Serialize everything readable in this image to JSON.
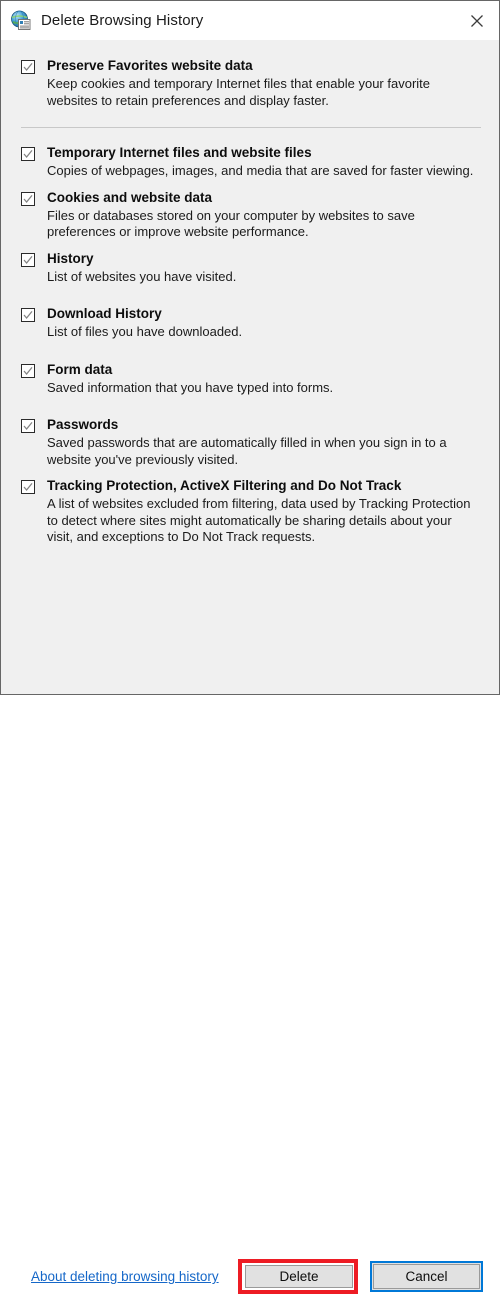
{
  "window": {
    "title": "Delete Browsing History",
    "icon": "internet-explorer-history-icon",
    "close_label": "✕"
  },
  "options": [
    {
      "id": "preserve-favorites",
      "title": "Preserve Favorites website data",
      "description": "Keep cookies and temporary Internet files that enable your favorite websites to retain preferences and display faster.",
      "checked": true
    },
    {
      "id": "temporary-internet-files",
      "title": "Temporary Internet files and website files",
      "description": "Copies of webpages, images, and media that are saved for faster viewing.",
      "checked": true
    },
    {
      "id": "cookies-and-website-data",
      "title": "Cookies and website data",
      "description": "Files or databases stored on your computer by websites to save preferences or improve website performance.",
      "checked": true
    },
    {
      "id": "history",
      "title": "History",
      "description": "List of websites you have visited.",
      "checked": true
    },
    {
      "id": "download-history",
      "title": "Download History",
      "description": "List of files you have downloaded.",
      "checked": true
    },
    {
      "id": "form-data",
      "title": "Form data",
      "description": "Saved information that you have typed into forms.",
      "checked": true
    },
    {
      "id": "passwords",
      "title": "Passwords",
      "description": "Saved passwords that are automatically filled in when you sign in to a website you've previously visited.",
      "checked": true
    },
    {
      "id": "tracking-protection",
      "title": "Tracking Protection, ActiveX Filtering and Do Not Track",
      "description": "A list of websites excluded from filtering, data used by Tracking Protection to detect where sites might automatically be sharing details about your visit, and exceptions to Do Not Track requests.",
      "checked": true
    }
  ],
  "footer": {
    "help_link": "About deleting browsing history",
    "delete_label": "Delete",
    "cancel_label": "Cancel"
  },
  "colors": {
    "dialog_background": "#f0f0f0",
    "titlebar_background": "#ffffff",
    "link": "#1567c8",
    "highlight_red": "#ed1c24",
    "focus_blue": "#0078d7",
    "button_face": "#e1e1e1"
  }
}
